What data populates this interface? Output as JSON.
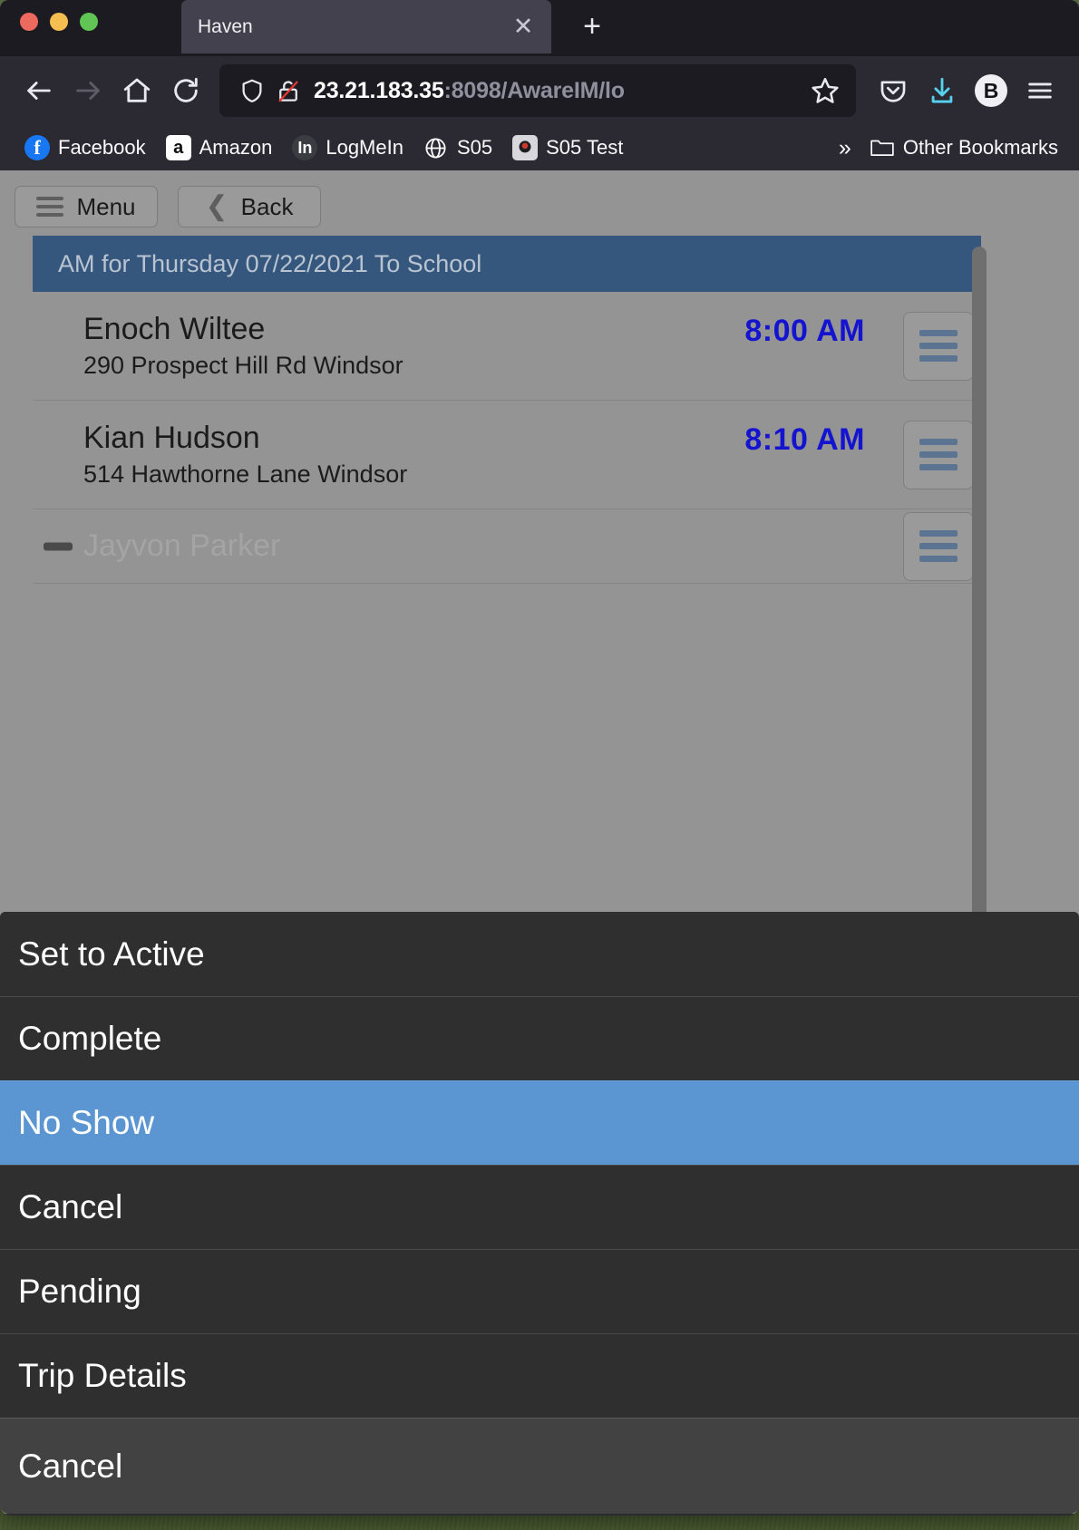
{
  "browser": {
    "tab": {
      "title": "Haven",
      "close_label": "✕"
    },
    "new_tab_label": "+",
    "nav": {
      "back": "back-arrow",
      "forward": "forward-arrow",
      "home": "home",
      "reload": "reload"
    },
    "url": {
      "host": "23.21.183.35",
      "rest": ":8098/AwareIM/lo",
      "shield_icon": "tracking-protection-shield",
      "lock_icon": "broken-lock-insecure",
      "star_icon": "bookmark-star"
    },
    "toolbar_right": {
      "pocket": "pocket-icon",
      "downloads": "download-arrow-icon",
      "account": "B",
      "menu": "hamburger-menu"
    },
    "bookmarks": [
      {
        "label": "Facebook",
        "icon": "facebook-icon",
        "glyph": "f"
      },
      {
        "label": "Amazon",
        "icon": "amazon-icon",
        "glyph": "a"
      },
      {
        "label": "LogMeIn",
        "icon": "logmein-icon",
        "glyph": "In"
      },
      {
        "label": "S05",
        "icon": "globe-icon",
        "glyph": ""
      },
      {
        "label": "S05 Test",
        "icon": "s05-test-icon",
        "glyph": ""
      }
    ],
    "overflow_label": "»",
    "other_bookmarks": "Other Bookmarks"
  },
  "app": {
    "toolbar": {
      "menu_label": "Menu",
      "back_label": "Back"
    },
    "list": {
      "header": "AM for Thursday 07/22/2021 To School",
      "rows": [
        {
          "name": "Enoch Wiltee",
          "address": "290 Prospect Hill Rd Windsor",
          "time": "8:00 AM",
          "muted": false
        },
        {
          "name": "Kian Hudson",
          "address": "514 Hawthorne Lane Windsor",
          "time": "8:10 AM",
          "muted": false
        },
        {
          "name": "Jayvon Parker",
          "address": "",
          "time": "",
          "muted": true
        }
      ]
    },
    "action_sheet": {
      "items": [
        {
          "label": "Set to Active",
          "selected": false,
          "final": false
        },
        {
          "label": "Complete",
          "selected": false,
          "final": false
        },
        {
          "label": "No Show",
          "selected": true,
          "final": false
        },
        {
          "label": "Cancel",
          "selected": false,
          "final": false
        },
        {
          "label": "Pending",
          "selected": false,
          "final": false
        },
        {
          "label": "Trip Details",
          "selected": false,
          "final": false
        },
        {
          "label": "Cancel",
          "selected": false,
          "final": true
        }
      ]
    }
  },
  "colors": {
    "accent_blue": "#5b96d2",
    "header_blue": "#35577e",
    "time_blue": "#1414d0",
    "page_gray": "#949494",
    "sheet_dark": "#2f2f2f",
    "chrome_dark": "#2b2a33"
  }
}
